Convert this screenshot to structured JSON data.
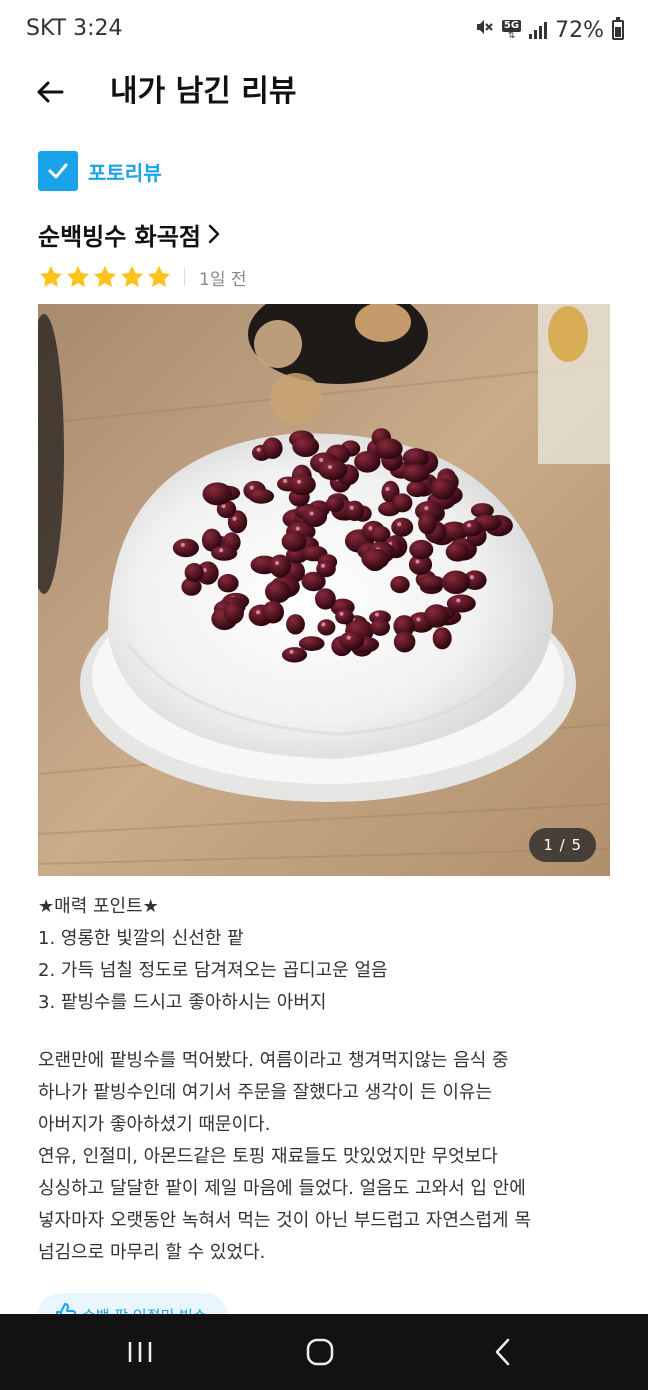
{
  "status_bar": {
    "carrier_time": "SKT 3:24",
    "icons": [
      "mute-icon",
      "5g-data-icon",
      "signal-icon",
      "battery-icon"
    ],
    "network": "5G",
    "battery": "72%",
    "battery_level": 0.72
  },
  "header": {
    "back_icon": "arrow-left-icon",
    "title": "내가 남긴 리뷰"
  },
  "review": {
    "tag_label": "포토리뷰",
    "store_name": "순백빙수 화곡점",
    "rating": 5,
    "rating_max": 5,
    "time_ago": "1일 전",
    "photo": {
      "counter": "1 / 5",
      "current": 1,
      "total": 5
    },
    "points": [
      "★매력 포인트★",
      "1. 영롱한 빛깔의 신선한 팥",
      "2. 가득 넘칠 정도로 담겨져오는 곱디고운 얼음",
      "3. 팥빙수를 드시고 좋아하시는 아버지"
    ],
    "body_lines": [
      "오랜만에 팥빙수를 먹어봤다. 여름이라고 챙겨먹지않는 음식 중",
      "하나가 팥빙수인데 여기서 주문을 잘했다고 생각이 든 이유는",
      "아버지가 좋아하셨기 때문이다.",
      "연유, 인절미, 아몬드같은 토핑 재료들도 맛있었지만 무엇보다",
      "싱싱하고 달달한 팥이 제일 마음에 들었다. 얼음도 고와서 입 안에",
      "넣자마자 오랫동안 녹혀서 먹는 것이 아닌 부드럽고 자연스럽게 목",
      "넘김으로 마무리 할 수 있었다."
    ],
    "menu_chip": "순백 팥 인절미 빙수"
  },
  "colors": {
    "accent": "#1aa3e8",
    "star": "#ffc21a",
    "nav_bar": "#121212"
  },
  "nav": {
    "icons": [
      "recent-apps-icon",
      "home-icon",
      "back-icon"
    ]
  }
}
